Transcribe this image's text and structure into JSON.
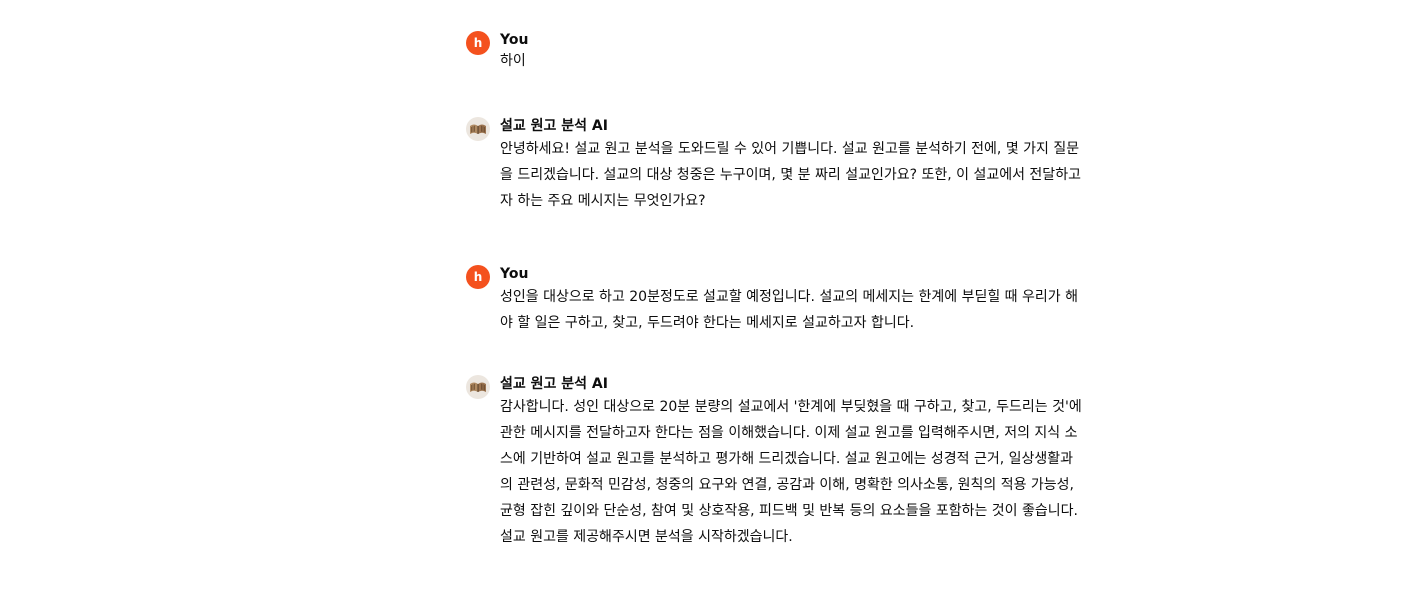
{
  "messages": [
    {
      "role": "user",
      "avatar_letter": "h",
      "author": "You",
      "text": "하이"
    },
    {
      "role": "assistant",
      "avatar_icon": "open-book-icon",
      "author": "설교 원고 분석 AI",
      "text": "안녕하세요! 설교 원고 분석을 도와드릴 수 있어 기쁩니다. 설교 원고를 분석하기 전에, 몇 가지 질문을 드리겠습니다. 설교의 대상 청중은 누구이며, 몇 분 짜리 설교인가요? 또한, 이 설교에서 전달하고자 하는 주요 메시지는 무엇인가요?"
    },
    {
      "role": "user",
      "avatar_letter": "h",
      "author": "You",
      "text": "성인을 대상으로 하고 20분정도로 설교할 예정입니다.  설교의 메세지는 한계에 부딛힐 때 우리가 해야 할 일은 구하고, 찾고, 두드려야 한다는 메세지로 설교하고자 합니다."
    },
    {
      "role": "assistant",
      "avatar_icon": "open-book-icon",
      "author": "설교 원고 분석 AI",
      "text": "감사합니다. 성인 대상으로 20분 분량의 설교에서 '한계에 부딪혔을 때 구하고, 찾고, 두드리는 것'에 관한 메시지를 전달하고자 한다는 점을 이해했습니다. 이제 설교 원고를 입력해주시면, 저의 지식 소스에 기반하여 설교 원고를 분석하고 평가해 드리겠습니다. 설교 원고에는 성경적 근거, 일상생활과의 관련성, 문화적 민감성, 청중의 요구와 연결, 공감과 이해, 명확한 의사소통, 원칙의 적용 가능성, 균형 잡힌 깊이와 단순성, 참여 및 상호작용, 피드백 및 반복 등의 요소들을 포함하는 것이 좋습니다. 설교 원고를 제공해주시면 분석을 시작하겠습니다."
    }
  ],
  "colors": {
    "user_avatar": "#f4511e",
    "text": "#0d0d0d",
    "background": "#ffffff"
  }
}
